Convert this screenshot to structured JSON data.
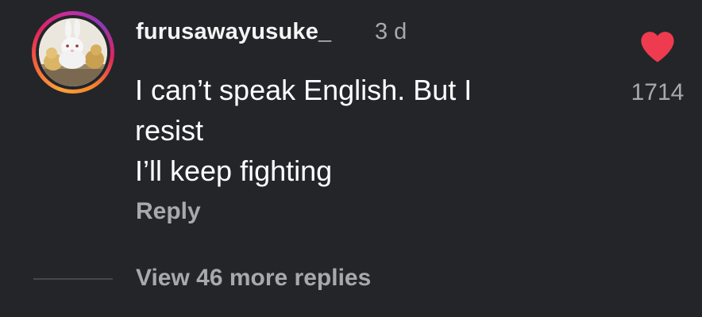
{
  "comment": {
    "username": "furusawayusuke_",
    "timestamp": "3 d",
    "text_lines": [
      "I can’t speak English. But I",
      "resist",
      "I’ll keep fighting"
    ],
    "reply_label": "Reply",
    "view_replies_label": "View 46 more replies",
    "like_count": "1714",
    "liked": true
  },
  "colors": {
    "background": "#232529",
    "text_primary": "#ffffff",
    "text_secondary": "#a8a9ab",
    "heart": "#ef3b4f"
  },
  "icons": {
    "like": "heart-icon",
    "avatar": "rabbit-and-chicks-photo"
  }
}
